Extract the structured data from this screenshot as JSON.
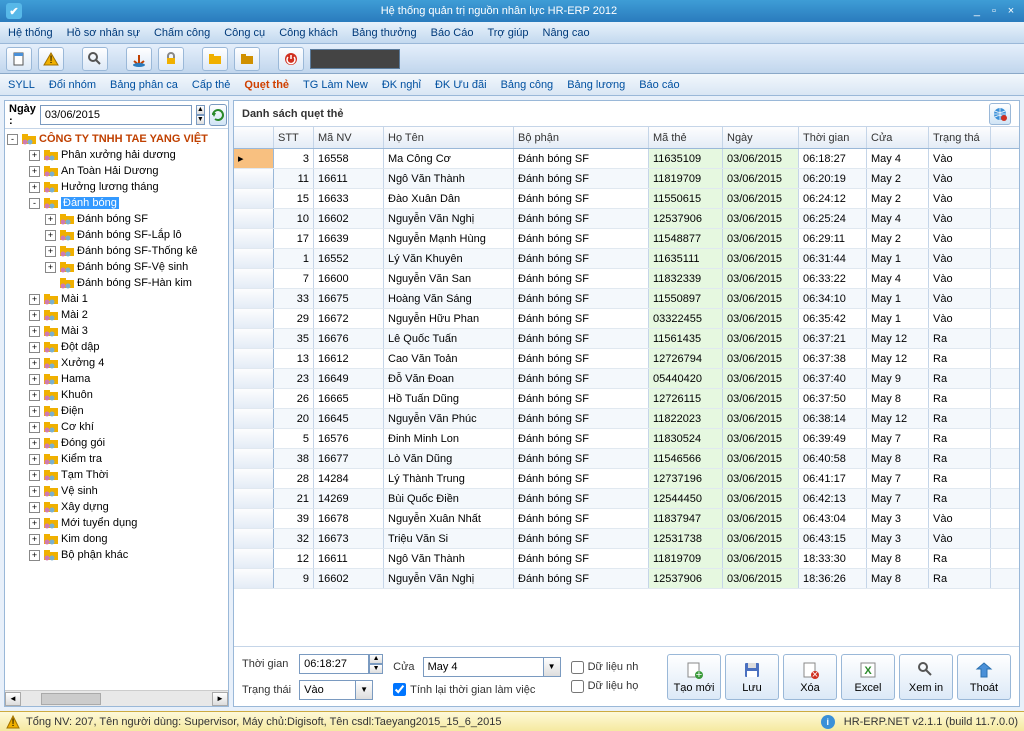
{
  "titlebar": {
    "title": "Hệ thống quản trị nguồn nhân lực HR-ERP 2012"
  },
  "menus": [
    "Hệ thống",
    "Hồ sơ nhân sự",
    "Chấm công",
    "Công cụ",
    "Công khách",
    "Bảng thưởng",
    "Báo Cáo",
    "Trợ giúp",
    "Nâng cao"
  ],
  "tabs": [
    "SYLL",
    "Đổi nhóm",
    "Bảng phân ca",
    "Cấp thẻ",
    "Quẹt thẻ",
    "TG Làm New",
    "ĐK nghỉ",
    "ĐK Ưu đãi",
    "Bảng công",
    "Bảng lương",
    "Báo cáo"
  ],
  "active_tab_index": 4,
  "left": {
    "label_ngay": "Ngày :",
    "date": "03/06/2015",
    "company": "CÔNG TY TNHH TAE YANG VIỆT",
    "tree": [
      {
        "lbl": "Phân xưởng hải dương",
        "d": 1,
        "e": "+"
      },
      {
        "lbl": "An Toàn Hải Dương",
        "d": 1,
        "e": "+"
      },
      {
        "lbl": "Hưởng lương tháng",
        "d": 1,
        "e": "+"
      },
      {
        "lbl": "Đánh bóng",
        "d": 1,
        "e": "-",
        "sel": true
      },
      {
        "lbl": "Đánh bóng SF",
        "d": 2,
        "e": "+"
      },
      {
        "lbl": "Đánh bóng SF-Lắp lô",
        "d": 2,
        "e": "+"
      },
      {
        "lbl": "Đánh bóng SF-Thống kê",
        "d": 2,
        "e": "+"
      },
      {
        "lbl": "Đánh bóng SF-Vệ sinh",
        "d": 2,
        "e": "+"
      },
      {
        "lbl": "Đánh bóng SF-Hàn kim",
        "d": 2,
        "e": " "
      },
      {
        "lbl": "Mài 1",
        "d": 1,
        "e": "+"
      },
      {
        "lbl": "Mài 2",
        "d": 1,
        "e": "+"
      },
      {
        "lbl": "Mài 3",
        "d": 1,
        "e": "+"
      },
      {
        "lbl": "Đột dập",
        "d": 1,
        "e": "+"
      },
      {
        "lbl": "Xưởng 4",
        "d": 1,
        "e": "+"
      },
      {
        "lbl": "Hama",
        "d": 1,
        "e": "+"
      },
      {
        "lbl": "Khuôn",
        "d": 1,
        "e": "+"
      },
      {
        "lbl": "Điện",
        "d": 1,
        "e": "+"
      },
      {
        "lbl": "Cơ khí",
        "d": 1,
        "e": "+"
      },
      {
        "lbl": "Đóng gói",
        "d": 1,
        "e": "+"
      },
      {
        "lbl": "Kiểm tra",
        "d": 1,
        "e": "+"
      },
      {
        "lbl": "Tạm Thời",
        "d": 1,
        "e": "+"
      },
      {
        "lbl": "Vệ sinh",
        "d": 1,
        "e": "+"
      },
      {
        "lbl": "Xây dựng",
        "d": 1,
        "e": "+"
      },
      {
        "lbl": "Mới tuyển dụng",
        "d": 1,
        "e": "+"
      },
      {
        "lbl": "Kim dong",
        "d": 1,
        "e": "+"
      },
      {
        "lbl": "Bộ phận khác",
        "d": 1,
        "e": "+"
      }
    ]
  },
  "grid": {
    "title": "Danh sách quẹt thẻ",
    "cols": [
      "STT",
      "Mã NV",
      "Họ Tên",
      "Bộ phận",
      "Mã thẻ",
      "Ngày",
      "Thời gian",
      "Cửa",
      "Trạng thá"
    ],
    "rows": [
      [
        "3",
        "16558",
        "Ma Công Cơ",
        "Đánh bóng SF",
        "11635109",
        "03/06/2015",
        "06:18:27",
        "May 4",
        "Vào"
      ],
      [
        "11",
        "16611",
        "Ngô Văn Thành",
        "Đánh bóng SF",
        "11819709",
        "03/06/2015",
        "06:20:19",
        "May 2",
        "Vào"
      ],
      [
        "15",
        "16633",
        "Đào Xuân Dân",
        "Đánh bóng SF",
        "11550615",
        "03/06/2015",
        "06:24:12",
        "May 2",
        "Vào"
      ],
      [
        "10",
        "16602",
        "Nguyễn Văn Nghị",
        "Đánh bóng SF",
        "12537906",
        "03/06/2015",
        "06:25:24",
        "May 4",
        "Vào"
      ],
      [
        "17",
        "16639",
        "Nguyễn Mạnh Hùng",
        "Đánh bóng SF",
        "11548877",
        "03/06/2015",
        "06:29:11",
        "May 2",
        "Vào"
      ],
      [
        "1",
        "16552",
        "Lý Văn Khuyên",
        "Đánh bóng SF",
        "11635111",
        "03/06/2015",
        "06:31:44",
        "May 1",
        "Vào"
      ],
      [
        "7",
        "16600",
        "Nguyễn Văn San",
        "Đánh bóng SF",
        "11832339",
        "03/06/2015",
        "06:33:22",
        "May 4",
        "Vào"
      ],
      [
        "33",
        "16675",
        "Hoàng Văn Sáng",
        "Đánh bóng SF",
        "11550897",
        "03/06/2015",
        "06:34:10",
        "May 1",
        "Vào"
      ],
      [
        "29",
        "16672",
        "Nguyễn Hữu Phan",
        "Đánh bóng SF",
        "03322455",
        "03/06/2015",
        "06:35:42",
        "May 1",
        "Vào"
      ],
      [
        "35",
        "16676",
        "Lê Quốc Tuấn",
        "Đánh bóng SF",
        "11561435",
        "03/06/2015",
        "06:37:21",
        "May 12",
        "Ra"
      ],
      [
        "13",
        "16612",
        "Cao Văn Toản",
        "Đánh bóng SF",
        "12726794",
        "03/06/2015",
        "06:37:38",
        "May 12",
        "Ra"
      ],
      [
        "23",
        "16649",
        "Đỗ Văn Đoan",
        "Đánh bóng SF",
        "05440420",
        "03/06/2015",
        "06:37:40",
        "May 9",
        "Ra"
      ],
      [
        "26",
        "16665",
        "Hồ Tuấn Dũng",
        "Đánh bóng SF",
        "12726115",
        "03/06/2015",
        "06:37:50",
        "May 8",
        "Ra"
      ],
      [
        "20",
        "16645",
        "Nguyễn Văn Phúc",
        "Đánh bóng SF",
        "11822023",
        "03/06/2015",
        "06:38:14",
        "May 12",
        "Ra"
      ],
      [
        "5",
        "16576",
        "Đinh Minh Lon",
        "Đánh bóng SF",
        "11830524",
        "03/06/2015",
        "06:39:49",
        "May 7",
        "Ra"
      ],
      [
        "38",
        "16677",
        "Lò Văn Dũng",
        "Đánh bóng SF",
        "11546566",
        "03/06/2015",
        "06:40:58",
        "May 8",
        "Ra"
      ],
      [
        "28",
        "14284",
        "Lý Thành Trung",
        "Đánh bóng SF",
        "12737196",
        "03/06/2015",
        "06:41:17",
        "May 7",
        "Ra"
      ],
      [
        "21",
        "14269",
        "Bùi Quốc Điền",
        "Đánh bóng SF",
        "12544450",
        "03/06/2015",
        "06:42:13",
        "May 7",
        "Ra"
      ],
      [
        "39",
        "16678",
        "Nguyễn Xuân Nhất",
        "Đánh bóng SF",
        "11837947",
        "03/06/2015",
        "06:43:04",
        "May 3",
        "Vào"
      ],
      [
        "32",
        "16673",
        "Triệu Văn Si",
        "Đánh bóng SF",
        "12531738",
        "03/06/2015",
        "06:43:15",
        "May 3",
        "Vào"
      ],
      [
        "12",
        "16611",
        "Ngô Văn Thành",
        "Đánh bóng SF",
        "11819709",
        "03/06/2015",
        "18:33:30",
        "May 8",
        "Ra"
      ],
      [
        "9",
        "16602",
        "Nguyễn Văn Nghị",
        "Đánh bóng SF",
        "12537906",
        "03/06/2015",
        "18:36:26",
        "May 8",
        "Ra"
      ]
    ]
  },
  "footer": {
    "lbl_thoigian": "Thời gian",
    "val_thoigian": "06:18:27",
    "lbl_cua": "Cửa",
    "val_cua": "May 4",
    "lbl_trangthai": "Trạng thái",
    "val_trangthai": "Vào",
    "chk1": "Dữ liệu nh",
    "chk2": "Tính lại thời gian làm việc",
    "chk3": "Dữ liệu họ",
    "btn_new": "Tạo mới",
    "btn_save": "Lưu",
    "btn_del": "Xóa",
    "btn_excel": "Excel",
    "btn_print": "Xem in",
    "btn_exit": "Thoát"
  },
  "status": {
    "text": "Tổng NV: 207, Tên người dùng: Supervisor, Máy chủ:Digisoft, Tên csdl:Taeyang2015_15_6_2015",
    "version": "HR-ERP.NET v2.1.1 (build 11.7.0.0)"
  }
}
